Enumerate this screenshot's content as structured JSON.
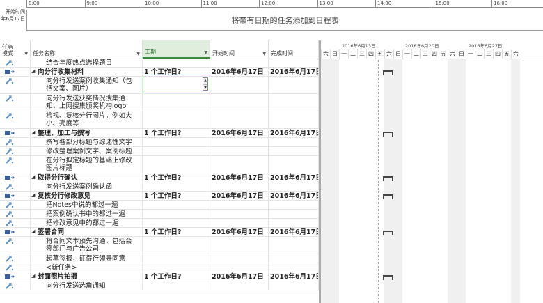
{
  "timeline": {
    "start_label": "开始时间",
    "start_date": "年6月17日",
    "hours": [
      "8:00",
      "9:00",
      "10:00",
      "11:00",
      "12:00",
      "13:00",
      "14:00",
      "15:00",
      "16:00"
    ],
    "bar_text": "将带有日期的任务添加到日程表"
  },
  "columns": {
    "mode": "任务\n模式",
    "name": "任务名称",
    "duration": "工期",
    "start": "开始时间",
    "finish": "完成时间"
  },
  "gantt": {
    "weeks": [
      "2016年6月13日",
      "2016年6月20日",
      "2016年6月27日"
    ],
    "days": [
      "六",
      "日",
      "一",
      "二",
      "三",
      "四",
      "五",
      "六",
      "日",
      "一",
      "二",
      "三",
      "四",
      "五",
      "六",
      "日",
      "一",
      "二",
      "三",
      "四",
      "五",
      "六"
    ]
  },
  "rows": [
    {
      "type": "task",
      "name": "结合年度热点选择题目",
      "duration": "",
      "start": "",
      "finish": ""
    },
    {
      "type": "summary",
      "name": "向分行收集材料",
      "duration": "1 个工作日?",
      "start": "2016年6月17日",
      "finish": "2016年6月17日"
    },
    {
      "type": "task",
      "name": "向分行发送案例收集通知（包括文案、图片）",
      "duration": "",
      "start": "",
      "finish": ""
    },
    {
      "type": "task",
      "name": "向分行发送获奖情况搜集通知，上网搜集颁奖机构logo",
      "duration": "",
      "start": "",
      "finish": ""
    },
    {
      "type": "task",
      "name": "检视、复核分行图片，例如大小、亮度等",
      "duration": "",
      "start": "",
      "finish": ""
    },
    {
      "type": "summary",
      "name": "整理、加工与撰写",
      "duration": "1 个工作日?",
      "start": "2016年6月17日",
      "finish": "2016年6月17日"
    },
    {
      "type": "task",
      "name": "撰写各部分标题与综述性文字",
      "duration": "",
      "start": "",
      "finish": ""
    },
    {
      "type": "task",
      "name": "修改整理案例文字、案例标题",
      "duration": "",
      "start": "",
      "finish": ""
    },
    {
      "type": "task",
      "name": "在分行拟定标题的基础上修改图片标题",
      "duration": "",
      "start": "",
      "finish": ""
    },
    {
      "type": "summary",
      "name": "取得分行确认",
      "duration": "1 个工作日?",
      "start": "2016年6月17日",
      "finish": "2016年6月17日"
    },
    {
      "type": "task",
      "name": "向分行发送案例确认函",
      "duration": "",
      "start": "",
      "finish": ""
    },
    {
      "type": "summary",
      "name": "复核分行修改意见",
      "duration": "1 个工作日?",
      "start": "2016年6月17日",
      "finish": "2016年6月17日"
    },
    {
      "type": "task",
      "name": "把Notes中说的都过一遍",
      "duration": "",
      "start": "",
      "finish": ""
    },
    {
      "type": "task",
      "name": "把案例确认书中的都过一遍",
      "duration": "",
      "start": "",
      "finish": ""
    },
    {
      "type": "task",
      "name": "把修改意见中的都过一遍",
      "duration": "",
      "start": "",
      "finish": ""
    },
    {
      "type": "summary",
      "name": "签署合同",
      "duration": "1 个工作日?",
      "start": "2016年6月17日",
      "finish": "2016年6月17日"
    },
    {
      "type": "task",
      "name": "将合同文本预先沟通，包括会签部门与广告公司",
      "duration": "",
      "start": "",
      "finish": ""
    },
    {
      "type": "task",
      "name": "起草签报，征得行领导同意",
      "duration": "",
      "start": "",
      "finish": ""
    },
    {
      "type": "task",
      "name": "<新任务>",
      "duration": "",
      "start": "",
      "finish": ""
    },
    {
      "type": "summary",
      "name": "封面照片拍摄",
      "duration": "1 个工作日?",
      "start": "2016年6月17日",
      "finish": "2016年6月17日"
    },
    {
      "type": "task",
      "name": "向分行发送选角通知",
      "duration": "",
      "start": "",
      "finish": ""
    }
  ],
  "colors": {
    "accent": "#3a8a3a",
    "summary_icon": "#3b5f9a",
    "task_icon": "#5b8fc9"
  }
}
